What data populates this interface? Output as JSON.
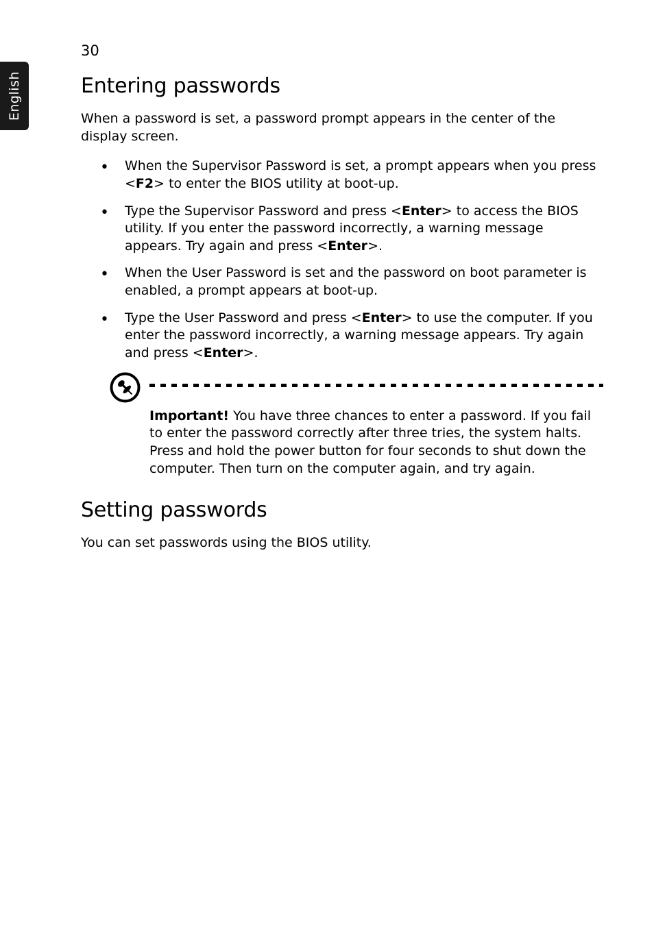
{
  "page_number": "30",
  "side_tab": "English",
  "heading1": "Entering passwords",
  "intro": "When a password is set, a password prompt appears in the center of the display screen.",
  "bullets": [
    {
      "pre": "When the Supervisor Password is set, a prompt appears when you press <",
      "key1": "F2",
      "post": "> to enter the BIOS utility at boot-up."
    },
    {
      "pre": "Type the Supervisor Password and press <",
      "key1": "Enter",
      "mid1": "> to access the BIOS utility. If you enter the password incorrectly, a warning message appears. Try again and press <",
      "key2": "Enter",
      "post": ">."
    },
    {
      "pre": "When the User Password is set and the password on boot parameter is enabled, a prompt appears at boot-up."
    },
    {
      "pre": "Type the User Password and press <",
      "key1": "Enter",
      "mid1": "> to use the computer. If you enter the password incorrectly, a warning message appears. Try again and press <",
      "key2": "Enter",
      "post": ">."
    }
  ],
  "note": {
    "label": "Important!",
    "text": " You have three chances to enter a password. If you fail to enter the password correctly after three tries, the system halts. Press and hold the power button for four seconds to shut down the computer. Then turn on the computer again, and try again."
  },
  "heading2": "Setting passwords",
  "setting_text": "You can set passwords using the BIOS utility."
}
